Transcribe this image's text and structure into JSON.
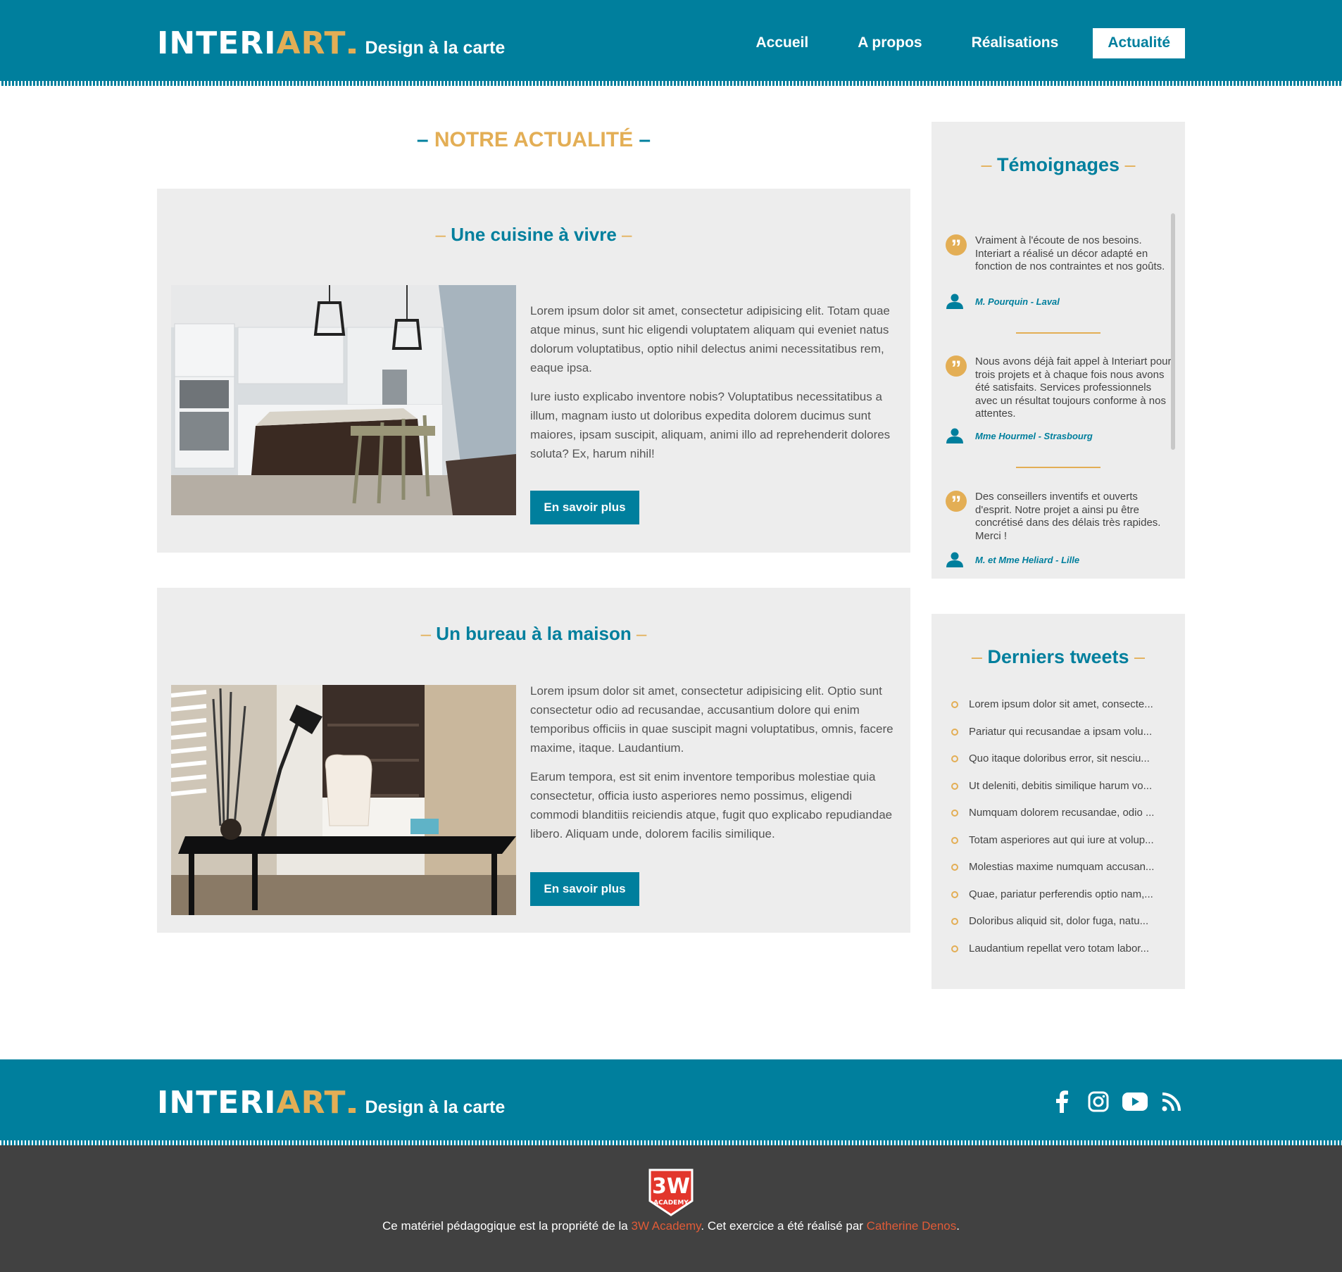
{
  "brand": {
    "logo_part1": "INTERI",
    "logo_part2": "ART",
    "tagline": "Design à la carte"
  },
  "nav": {
    "items": [
      {
        "label": "Accueil"
      },
      {
        "label": "A propos"
      },
      {
        "label": "Réalisations"
      },
      {
        "label": "Actualité"
      }
    ],
    "active_label": "Actualité"
  },
  "main": {
    "title": "NOTRE ACTUALITÉ",
    "articles": [
      {
        "title": "Une cuisine à vivre",
        "image": "kitchen-photo",
        "paragraphs": [
          "Lorem ipsum dolor sit amet, consectetur adipisicing elit. Totam quae atque minus, sunt hic eligendi voluptatem aliquam qui eveniet natus dolorum voluptatibus, optio nihil delectus animi necessitatibus rem, eaque ipsa.",
          "Iure iusto explicabo inventore nobis? Voluptatibus necessitatibus a illum, magnam iusto ut doloribus expedita dolorem ducimus sunt maiores, ipsam suscipit, aliquam, animi illo ad reprehenderit dolores soluta? Ex, harum nihil!"
        ],
        "button": "En savoir plus"
      },
      {
        "title": "Un bureau à la maison",
        "image": "home-office-photo",
        "paragraphs": [
          "Lorem ipsum dolor sit amet, consectetur adipisicing elit. Optio sunt consectetur odio ad recusandae, accusantium dolore qui enim temporibus officiis in quae suscipit magni voluptatibus, omnis, facere maxime, itaque. Laudantium.",
          "Earum tempora, est sit enim inventore temporibus molestiae quia consectetur, officia iusto asperiores nemo possimus, eligendi commodi blanditiis reiciendis atque, fugit quo explicabo repudiandae libero. Aliquam unde, dolorem facilis similique."
        ],
        "button": "En savoir plus"
      }
    ]
  },
  "sidebar": {
    "testimonials": {
      "title": "Témoignages",
      "items": [
        {
          "text": "Vraiment à l'écoute de nos besoins. Interiart a réalisé un décor adapté en fonction de nos contraintes et nos goûts.",
          "author": "M. Pourquin - Laval"
        },
        {
          "text": "Nous avons déjà fait appel à Interiart pour trois projets et à chaque fois nous avons été satisfaits. Services professionnels avec un résultat toujours conforme à nos attentes.",
          "author": "Mme Hourmel - Strasbourg"
        },
        {
          "text": "Des conseillers inventifs et ouverts d'esprit. Notre projet a ainsi pu être concrétisé dans des délais très rapides. Merci !",
          "author": "M. et Mme Heliard - Lille"
        }
      ]
    },
    "tweets": {
      "title": "Derniers tweets",
      "items": [
        "Lorem ipsum dolor sit amet, consecte...",
        "Pariatur qui recusandae a ipsam volu...",
        "Quo itaque doloribus error, sit nesciu...",
        "Ut deleniti, debitis similique harum vo...",
        "Numquam dolorem recusandae, odio ...",
        "Totam asperiores aut qui iure at volup...",
        "Molestias maxime numquam accusan...",
        "Quae, pariatur perferendis optio nam,...",
        "Doloribus aliquid sit, dolor fuga, natu...",
        "Laudantium repellat vero totam labor..."
      ]
    }
  },
  "footer": {
    "social_icons": [
      "facebook-icon",
      "instagram-icon",
      "youtube-icon",
      "rss-icon"
    ],
    "academy_logo_text": "3W",
    "academy_logo_sub": "ACADEMY",
    "credits": {
      "prefix": "Ce matériel pédagogique est la propriété de la ",
      "link1": "3W Academy",
      "middle": ". Cet exercice a été réalisé par ",
      "link2": "Catherine Denos",
      "suffix": "."
    }
  },
  "colors": {
    "primary": "#007f9d",
    "accent": "#e3ae55",
    "panel": "#ededed",
    "footer_dark": "#414141",
    "link": "#e05b37"
  }
}
